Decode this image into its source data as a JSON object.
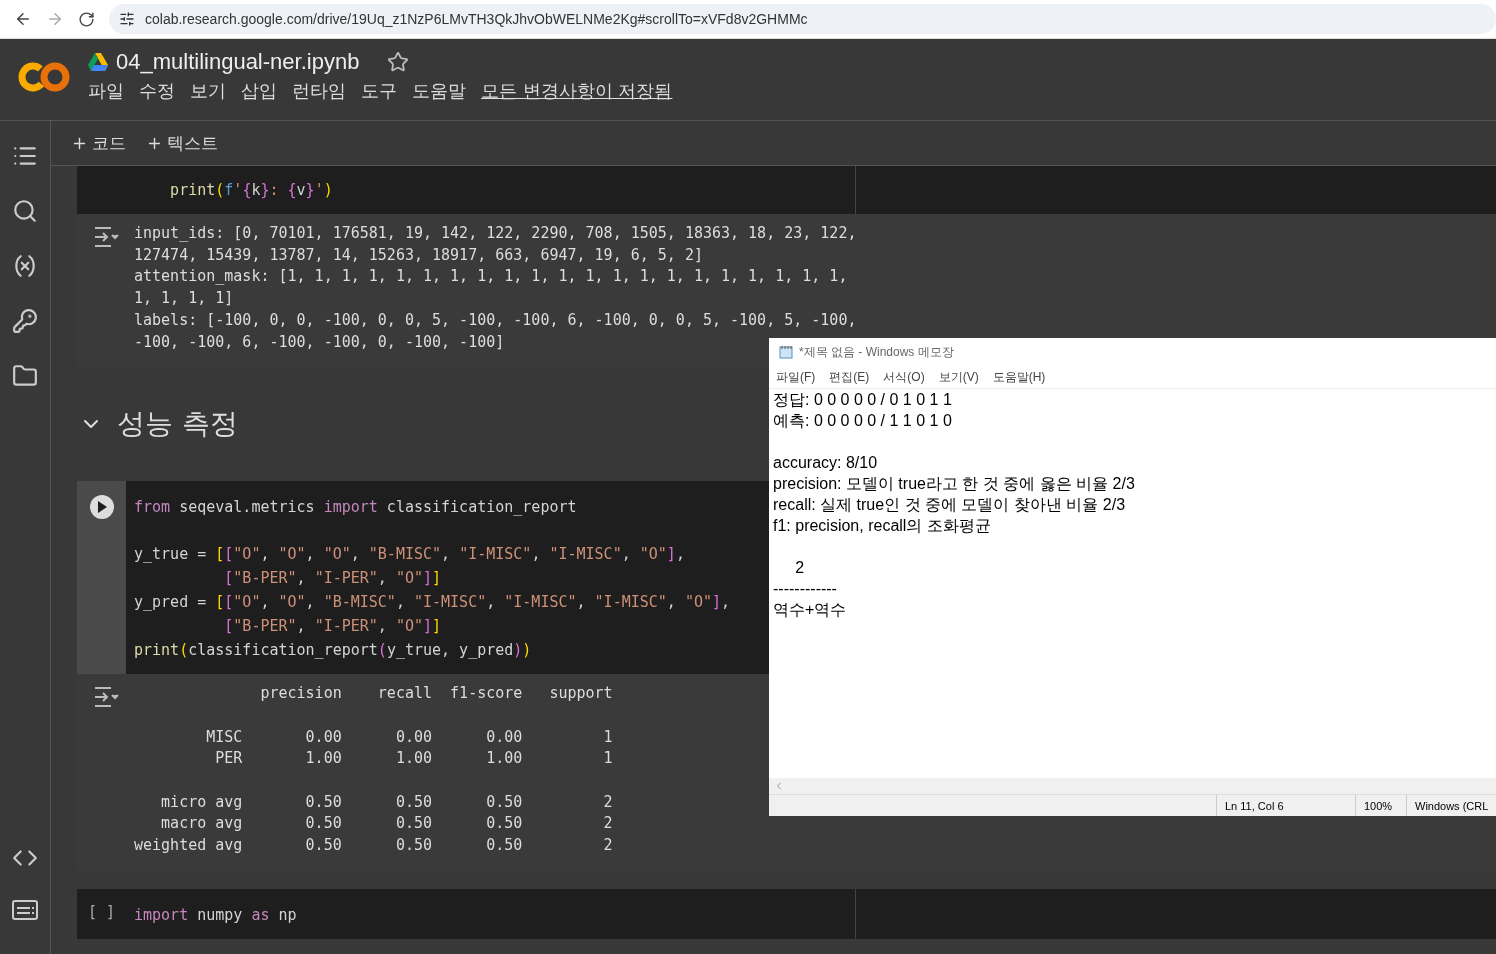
{
  "browser": {
    "url": "colab.research.google.com/drive/19Uq_z1NzP6LMvTH3QkJhvObWELNMe2Kg#scrollTo=xVFd8v2GHMMc"
  },
  "notebook": {
    "title": "04_multilingual-ner.ipynb",
    "starred": false,
    "menu": [
      {
        "label": "파일",
        "kind": "menu"
      },
      {
        "label": "수정",
        "kind": "menu"
      },
      {
        "label": "보기",
        "kind": "menu"
      },
      {
        "label": "삽입",
        "kind": "menu"
      },
      {
        "label": "런타임",
        "kind": "menu"
      },
      {
        "label": "도구",
        "kind": "menu"
      },
      {
        "label": "도움말",
        "kind": "menu"
      },
      {
        "label": "모든 변경사항이 저장됨",
        "kind": "link"
      }
    ]
  },
  "toolbar": [
    {
      "label": "코드"
    },
    {
      "label": "텍스트"
    }
  ],
  "cells": [
    {
      "kind": "code",
      "gutter": {
        "kind": "none"
      },
      "lines": [
        {
          "kind": "code",
          "tokens": [
            {
              "text": "    print",
              "kind": "func"
            },
            {
              "text": "(",
              "kind": "bracket1"
            },
            {
              "text": "f",
              "kind": "storage"
            },
            {
              "text": "'",
              "kind": "string"
            },
            {
              "text": "{",
              "kind": "bracket2"
            },
            {
              "text": "k",
              "kind": "plain"
            },
            {
              "text": "}",
              "kind": "bracket2"
            },
            {
              "text": ": ",
              "kind": "string"
            },
            {
              "text": "{",
              "kind": "bracket2"
            },
            {
              "text": "v",
              "kind": "plain"
            },
            {
              "text": "}",
              "kind": "bracket2"
            },
            {
              "text": "'",
              "kind": "string"
            },
            {
              "text": ")",
              "kind": "bracket1"
            }
          ]
        }
      ],
      "output": [
        {
          "kind": "text",
          "text": "input_ids: [0, 70101, 176581, 19, 142, 122, 2290, 708, 1505, 18363, 18, 23, 122,"
        },
        {
          "kind": "text",
          "text": "127474, 15439, 13787, 14, 15263, 18917, 663, 6947, 19, 6, 5, 2]"
        },
        {
          "kind": "text",
          "text": "attention_mask: [1, 1, 1, 1, 1, 1, 1, 1, 1, 1, 1, 1, 1, 1, 1, 1, 1, 1, 1, 1, 1,"
        },
        {
          "kind": "text",
          "text": "1, 1, 1, 1]"
        },
        {
          "kind": "text",
          "text": "labels: [-100, 0, 0, -100, 0, 0, 5, -100, -100, 6, -100, 0, 0, 5, -100, 5, -100,"
        },
        {
          "kind": "text",
          "text": "-100, -100, 6, -100, -100, 0, -100, -100]"
        }
      ]
    },
    {
      "kind": "heading",
      "expanded": true,
      "text": "성능 측정"
    },
    {
      "kind": "code",
      "gutter": {
        "kind": "run"
      },
      "lines": [
        {
          "kind": "code",
          "tokens": [
            {
              "text": "from",
              "kind": "keyword"
            },
            {
              "text": " seqeval.metrics ",
              "kind": "plain"
            },
            {
              "text": "import",
              "kind": "keyword"
            },
            {
              "text": " classification_report",
              "kind": "plain"
            }
          ]
        },
        {
          "kind": "blank"
        },
        {
          "kind": "code",
          "tokens": [
            {
              "text": "y_true = ",
              "kind": "plain"
            },
            {
              "text": "[",
              "kind": "bracket1"
            },
            {
              "text": "[",
              "kind": "bracket2"
            },
            {
              "text": "\"O\"",
              "kind": "string"
            },
            {
              "text": ", ",
              "kind": "plain"
            },
            {
              "text": "\"O\"",
              "kind": "string"
            },
            {
              "text": ", ",
              "kind": "plain"
            },
            {
              "text": "\"O\"",
              "kind": "string"
            },
            {
              "text": ", ",
              "kind": "plain"
            },
            {
              "text": "\"B-MISC\"",
              "kind": "string"
            },
            {
              "text": ", ",
              "kind": "plain"
            },
            {
              "text": "\"I-MISC\"",
              "kind": "string"
            },
            {
              "text": ", ",
              "kind": "plain"
            },
            {
              "text": "\"I-MISC\"",
              "kind": "string"
            },
            {
              "text": ", ",
              "kind": "plain"
            },
            {
              "text": "\"O\"",
              "kind": "string"
            },
            {
              "text": "]",
              "kind": "bracket2"
            },
            {
              "text": ",",
              "kind": "plain"
            }
          ]
        },
        {
          "kind": "code",
          "tokens": [
            {
              "text": "          [",
              "kind": "bracket2"
            },
            {
              "text": "\"B-PER\"",
              "kind": "string"
            },
            {
              "text": ", ",
              "kind": "plain"
            },
            {
              "text": "\"I-PER\"",
              "kind": "string"
            },
            {
              "text": ", ",
              "kind": "plain"
            },
            {
              "text": "\"O\"",
              "kind": "string"
            },
            {
              "text": "]",
              "kind": "bracket2"
            },
            {
              "text": "]",
              "kind": "bracket1"
            }
          ]
        },
        {
          "kind": "code",
          "tokens": [
            {
              "text": "y_pred = ",
              "kind": "plain"
            },
            {
              "text": "[",
              "kind": "bracket1"
            },
            {
              "text": "[",
              "kind": "bracket2"
            },
            {
              "text": "\"O\"",
              "kind": "string"
            },
            {
              "text": ", ",
              "kind": "plain"
            },
            {
              "text": "\"O\"",
              "kind": "string"
            },
            {
              "text": ", ",
              "kind": "plain"
            },
            {
              "text": "\"B-MISC\"",
              "kind": "string"
            },
            {
              "text": ", ",
              "kind": "plain"
            },
            {
              "text": "\"I-MISC\"",
              "kind": "string"
            },
            {
              "text": ", ",
              "kind": "plain"
            },
            {
              "text": "\"I-MISC\"",
              "kind": "string"
            },
            {
              "text": ", ",
              "kind": "plain"
            },
            {
              "text": "\"I-MISC\"",
              "kind": "string"
            },
            {
              "text": ", ",
              "kind": "plain"
            },
            {
              "text": "\"O\"",
              "kind": "string"
            },
            {
              "text": "]",
              "kind": "bracket2"
            },
            {
              "text": ",",
              "kind": "plain"
            }
          ]
        },
        {
          "kind": "code",
          "tokens": [
            {
              "text": "          [",
              "kind": "bracket2"
            },
            {
              "text": "\"B-PER\"",
              "kind": "string"
            },
            {
              "text": ", ",
              "kind": "plain"
            },
            {
              "text": "\"I-PER\"",
              "kind": "string"
            },
            {
              "text": ", ",
              "kind": "plain"
            },
            {
              "text": "\"O\"",
              "kind": "string"
            },
            {
              "text": "]",
              "kind": "bracket2"
            },
            {
              "text": "]",
              "kind": "bracket1"
            }
          ]
        },
        {
          "kind": "code",
          "tokens": [
            {
              "text": "print",
              "kind": "func"
            },
            {
              "text": "(",
              "kind": "bracket1"
            },
            {
              "text": "classification_report",
              "kind": "plain"
            },
            {
              "text": "(",
              "kind": "bracket2"
            },
            {
              "text": "y_true, y_pred",
              "kind": "plain"
            },
            {
              "text": ")",
              "kind": "bracket2"
            },
            {
              "text": ")",
              "kind": "bracket1"
            }
          ]
        }
      ],
      "output": [
        {
          "kind": "text",
          "text": "              precision    recall  f1-score   support"
        },
        {
          "kind": "blank"
        },
        {
          "kind": "text",
          "text": "        MISC       0.00      0.00      0.00         1"
        },
        {
          "kind": "text",
          "text": "         PER       1.00      1.00      1.00         1"
        },
        {
          "kind": "blank"
        },
        {
          "kind": "text",
          "text": "   micro avg       0.50      0.50      0.50         2"
        },
        {
          "kind": "text",
          "text": "   macro avg       0.50      0.50      0.50         2"
        },
        {
          "kind": "text",
          "text": "weighted avg       0.50      0.50      0.50         2"
        }
      ]
    },
    {
      "kind": "code",
      "gutter": {
        "kind": "idle",
        "text": "[ ]"
      },
      "lines": [
        {
          "kind": "code",
          "tokens": [
            {
              "text": "import",
              "kind": "keyword"
            },
            {
              "text": " numpy ",
              "kind": "plain"
            },
            {
              "text": "as",
              "kind": "keyword"
            },
            {
              "text": " np",
              "kind": "plain"
            }
          ]
        }
      ]
    }
  ],
  "notepad": {
    "title": "*제목 없음 - Windows 메모장",
    "menu": [
      "파일(F)",
      "편집(E)",
      "서식(O)",
      "보기(V)",
      "도움말(H)"
    ],
    "content": "정답: 0 0 0 0 0 / 0 1 0 1 1\n예측: 0 0 0 0 0 / 1 1 0 1 0\n\naccuracy: 8/10\nprecision: 모델이 true라고 한 것 중에 옳은 비율 2/3\nrecall: 실제 true인 것 중에 모델이 찾아낸 비율 2/3\nf1: precision, recall의 조화평균\n\n     2\n------------\n역수+역수",
    "status": [
      "Ln 11, Col 6",
      "100%",
      "Windows (CRL"
    ]
  }
}
